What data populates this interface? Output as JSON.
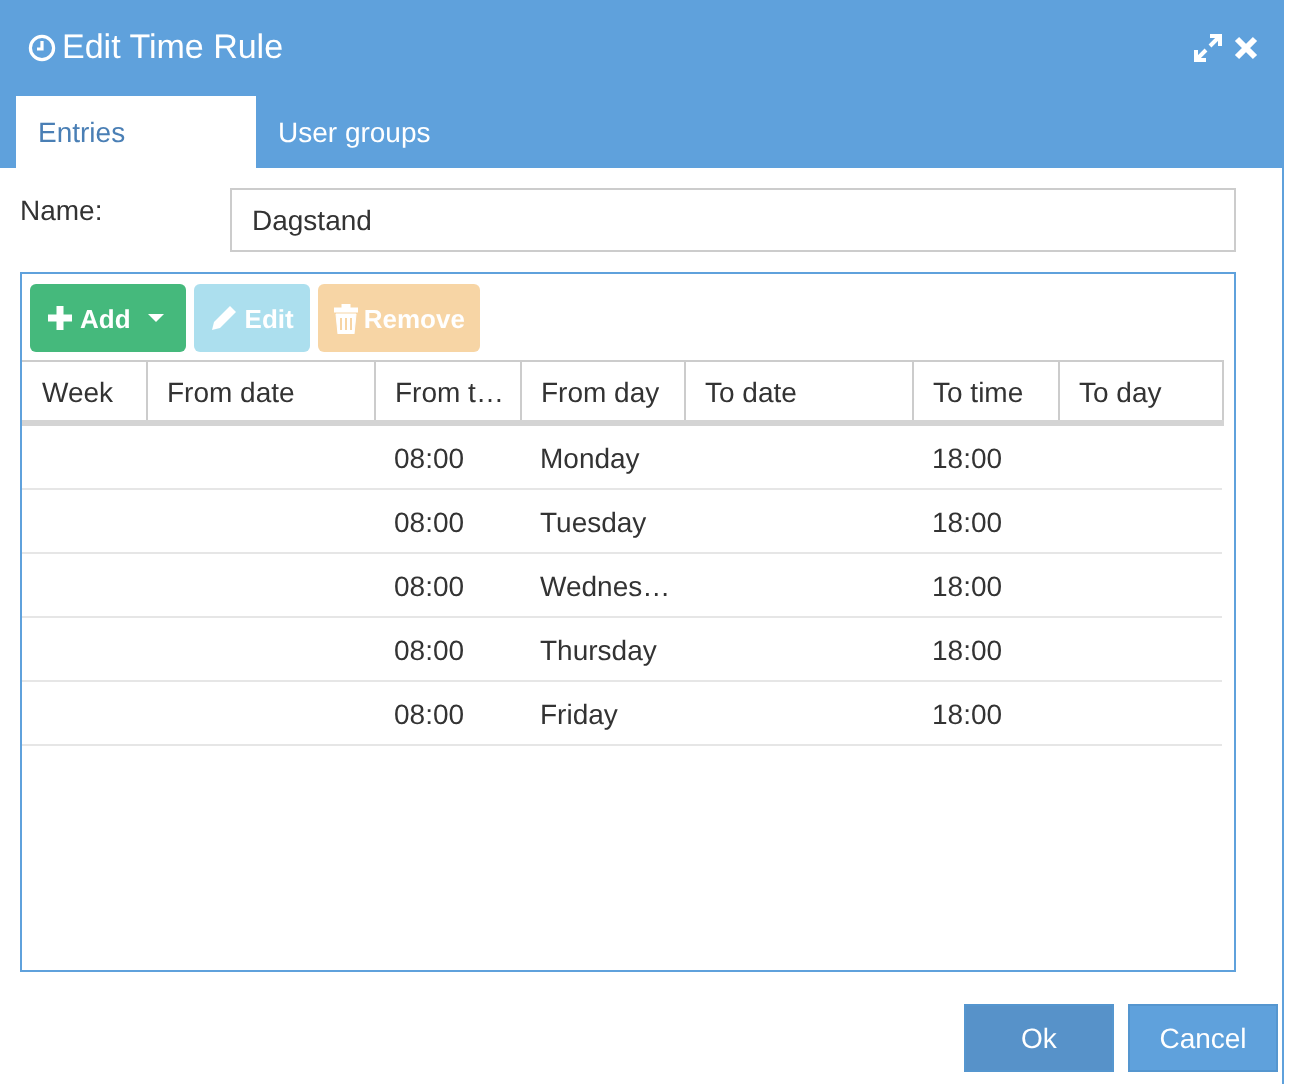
{
  "window": {
    "title": "Edit Time Rule"
  },
  "tabs": [
    {
      "label": "Entries",
      "selected": true
    },
    {
      "label": "User groups",
      "selected": false
    }
  ],
  "name_field": {
    "label": "Name:",
    "value": "Dagstand"
  },
  "toolbar": [
    {
      "kind": "add",
      "label": "Add",
      "disabled": false
    },
    {
      "kind": "edit",
      "label": "Edit",
      "disabled": true
    },
    {
      "kind": "remove",
      "label": "Remove",
      "disabled": true
    }
  ],
  "table": {
    "columns": [
      "Week",
      "From date",
      "From t…",
      "From day",
      "To date",
      "To time",
      "To day"
    ],
    "rows": [
      [
        "",
        "",
        "08:00",
        "Monday",
        "",
        "18:00",
        ""
      ],
      [
        "",
        "",
        "08:00",
        "Tuesday",
        "",
        "18:00",
        ""
      ],
      [
        "",
        "",
        "08:00",
        "Wednes…",
        "",
        "18:00",
        ""
      ],
      [
        "",
        "",
        "08:00",
        "Thursday",
        "",
        "18:00",
        ""
      ],
      [
        "",
        "",
        "08:00",
        "Friday",
        "",
        "18:00",
        ""
      ]
    ]
  },
  "buttons": [
    {
      "label": "Ok",
      "kind": "primary"
    },
    {
      "label": "Cancel",
      "kind": "secondary"
    }
  ]
}
